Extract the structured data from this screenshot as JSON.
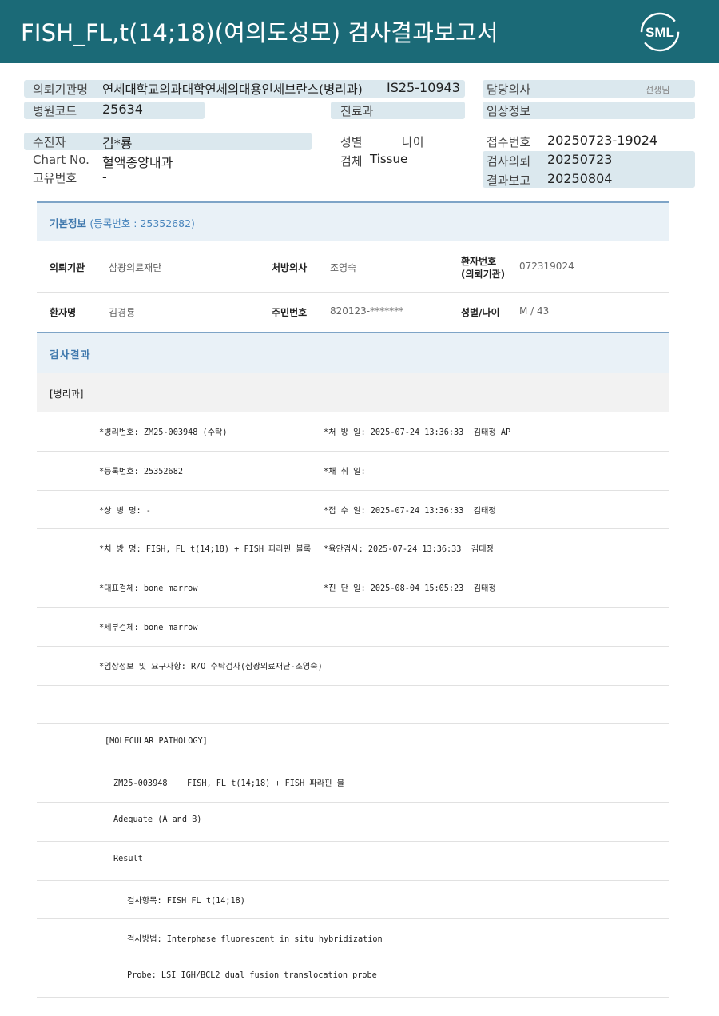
{
  "header": {
    "title": "FISH_FL,t(14;18)(여의도성모) 검사결과보고서",
    "logo_text": "SML",
    "bg_color": "#1b6a77"
  },
  "top_info": {
    "referral_org_label": "의뢰기관명",
    "referral_org_value": "연세대학교의과대학연세의대용인세브란스(병리과)",
    "report_no": "IS25-10943",
    "doctor_label": "담당의사",
    "doctor_suffix": "선생님",
    "hospital_code_label": "병원코드",
    "hospital_code_value": "25634",
    "department_label": "진료과",
    "clinical_info_label": "임상정보",
    "patient_label": "수진자",
    "patient_value": "김*룡",
    "sex_label": "성별",
    "age_label": "나이",
    "receipt_no_label": "접수번호",
    "receipt_no_value": "20250723-19024",
    "chart_label": "Chart No.",
    "chart_value": "혈액종양내과",
    "specimen_label": "검체",
    "specimen_value": "Tissue",
    "request_label": "검사의뢰",
    "request_value": "20250723",
    "unique_no_label": "고유번호",
    "unique_no_value": "-",
    "result_report_label": "결과보고",
    "result_report_value": "20250804"
  },
  "basic": {
    "title": "기본정보",
    "subtitle": "(등록번호 : 25352682)",
    "org_label": "의뢰기관",
    "org_value": "삼광의료재단",
    "doctor_label": "처방의사",
    "doctor_value": "조영숙",
    "patient_no_label_1": "환자번호",
    "patient_no_label_2": "(의뢰기관)",
    "patient_no_value": "072319024",
    "name_label": "환자명",
    "name_value": "김경룡",
    "rrn_label": "주민번호",
    "rrn_value": "820123-*******",
    "sexage_label": "성별/나이",
    "sexage_value": "M / 43"
  },
  "result": {
    "title": "검사결과",
    "dept": "[병리과]",
    "rows": [
      {
        "left": "*병리번호: ZM25-003948 (수탁)",
        "right": "*처 방 일: 2025-07-24 13:36:33  김태정 AP"
      },
      {
        "left": "*등록번호: 25352682",
        "right": "*채 취 일:"
      },
      {
        "left": "*상 병 명: -",
        "right": "*접 수 일: 2025-07-24 13:36:33  김태정"
      },
      {
        "left": "*처 방 명: FISH, FL t(14;18) + FISH 파라핀 블록",
        "right": "*육안검사: 2025-07-24 13:36:33  김태정"
      },
      {
        "left": "*대표검체: bone marrow",
        "right": "*진 단 일: 2025-08-04 15:05:23  김태정"
      },
      {
        "left": "*세부검체: bone marrow",
        "right": ""
      },
      {
        "left": "*임상정보 및 요구사항: R/O 수탁검사(삼광의료재단-조영숙)",
        "right": ""
      }
    ],
    "molecular": [
      "[MOLECULAR PATHOLOGY]",
      "ZM25-003948    FISH, FL t(14;18) + FISH 파라핀 블",
      "Adequate (A and B)",
      "Result",
      "검사항목: FISH FL t(14;18)",
      "검사방법: Interphase fluorescent in situ hybridization",
      "Probe: LSI IGH/BCL2 dual fusion translocation probe"
    ]
  }
}
